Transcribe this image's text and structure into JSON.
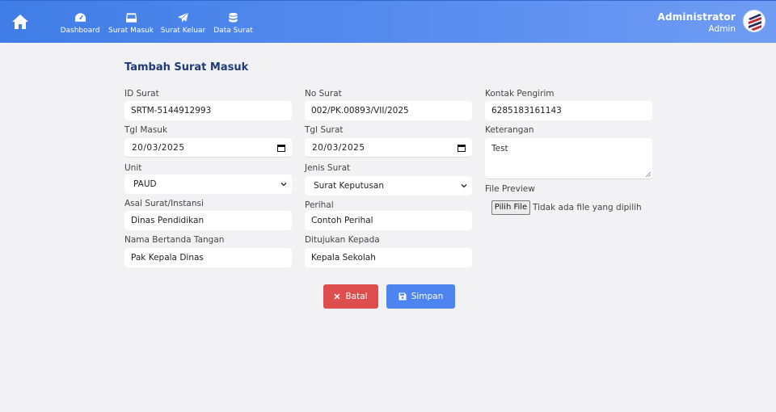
{
  "nav": {
    "items": [
      {
        "label": "Dashboard",
        "icon": "gauge-icon"
      },
      {
        "label": "Surat Masuk",
        "icon": "inbox-icon"
      },
      {
        "label": "Surat Keluar",
        "icon": "paper-plane-icon"
      },
      {
        "label": "Data Surat",
        "icon": "database-icon"
      }
    ]
  },
  "user": {
    "name": "Administrator",
    "role": "Admin"
  },
  "colors": {
    "header": "#4f87ee",
    "title": "#1f3a78",
    "cancel": "#de4e4e",
    "save": "#4d84ef"
  },
  "form": {
    "title": "Tambah Surat Masuk",
    "id_surat": {
      "label": "ID Surat",
      "value": "SRTM-5144912993"
    },
    "no_surat": {
      "label": "No Surat",
      "value": "002/PK.00893/VII/2025"
    },
    "kontak": {
      "label": "Kontak Pengirim",
      "value": "6285183161143"
    },
    "tgl_masuk": {
      "label": "Tgl Masuk",
      "value": "20/03/2025"
    },
    "tgl_surat": {
      "label": "Tgl Surat",
      "value": "20/03/2025"
    },
    "keterangan": {
      "label": "Keterangan",
      "value": "Test"
    },
    "unit": {
      "label": "Unit",
      "value": "PAUD"
    },
    "jenis": {
      "label": "Jenis Surat",
      "value": "Surat Keputusan"
    },
    "file": {
      "label": "File Preview",
      "button": "Pilih File",
      "status": "Tidak ada file yang dipilih"
    },
    "asal": {
      "label": "Asal Surat/Instansi",
      "value": "Dinas Pendidikan"
    },
    "perihal": {
      "label": "Perihal",
      "value": "Contoh Perihal"
    },
    "bertanda": {
      "label": "Nama Bertanda Tangan",
      "value": "Pak Kepala Dinas"
    },
    "ditujukan": {
      "label": "Ditujukan Kepada",
      "value": "Kepala Sekolah"
    }
  },
  "buttons": {
    "cancel": "Batal",
    "save": "Simpan"
  }
}
